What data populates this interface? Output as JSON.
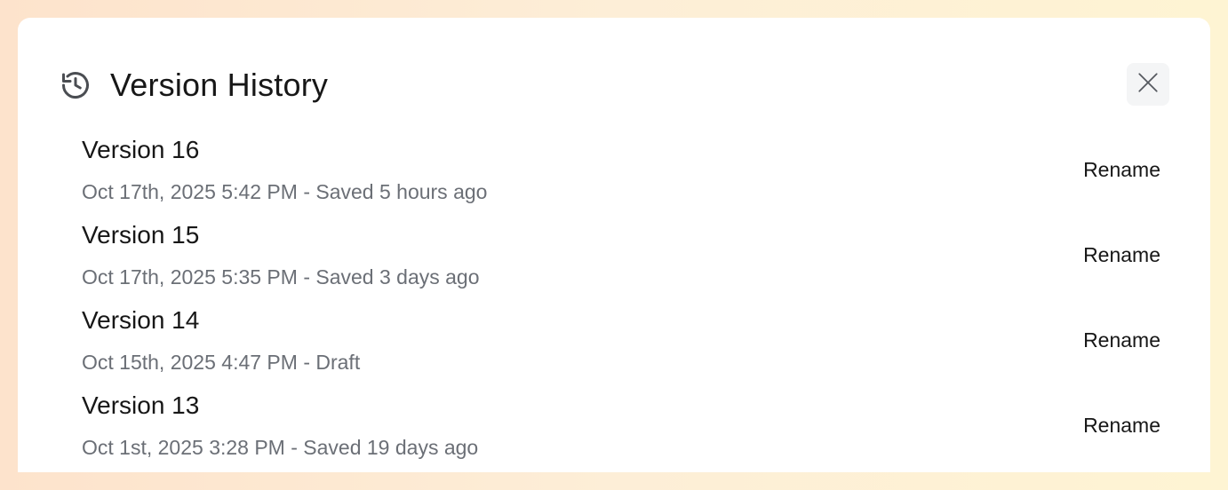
{
  "dialog": {
    "title": "Version History",
    "close_icon": "close-icon",
    "history_icon": "history-icon"
  },
  "versions": [
    {
      "name": "Version 16",
      "meta": "Oct 17th, 2025 5:42 PM - Saved 5 hours ago",
      "action": "Rename"
    },
    {
      "name": "Version 15",
      "meta": "Oct 17th, 2025 5:35 PM - Saved 3 days ago",
      "action": "Rename"
    },
    {
      "name": "Version 14",
      "meta": "Oct 15th, 2025 4:47 PM - Draft",
      "action": "Rename"
    },
    {
      "name": "Version 13",
      "meta": "Oct 1st, 2025 3:28 PM - Saved 19 days ago",
      "action": "Rename"
    }
  ],
  "colors": {
    "background_start": "#fde3cc",
    "background_end": "#fef4d3",
    "panel": "#ffffff",
    "text_primary": "#171717",
    "text_secondary": "#6b6f76",
    "close_button_bg": "#f4f5f6"
  }
}
